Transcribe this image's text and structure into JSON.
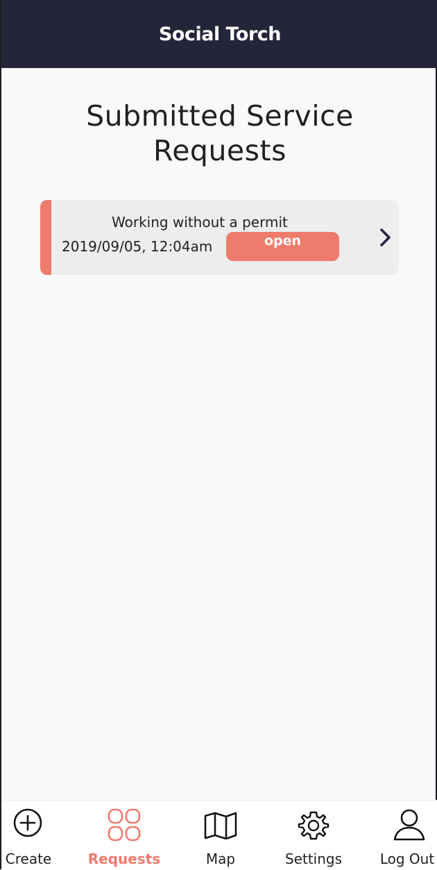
{
  "app": {
    "title": "Social Torch"
  },
  "page": {
    "title": "Submitted Service Requests"
  },
  "requests": [
    {
      "title": "Working without a permit",
      "datetime": "2019/09/05, 12:04am",
      "status": "open"
    }
  ],
  "tabs": [
    {
      "label": "Create",
      "icon": "plus-circle-icon",
      "active": false
    },
    {
      "label": "Requests",
      "icon": "grid-icon",
      "active": true
    },
    {
      "label": "Map",
      "icon": "map-icon",
      "active": false
    },
    {
      "label": "Settings",
      "icon": "gear-icon",
      "active": false
    },
    {
      "label": "Log Out",
      "icon": "user-icon",
      "active": false
    }
  ],
  "colors": {
    "header": "#25253a",
    "accent": "#ef7b6c",
    "card": "#ededee",
    "background": "#f9f9f9"
  }
}
